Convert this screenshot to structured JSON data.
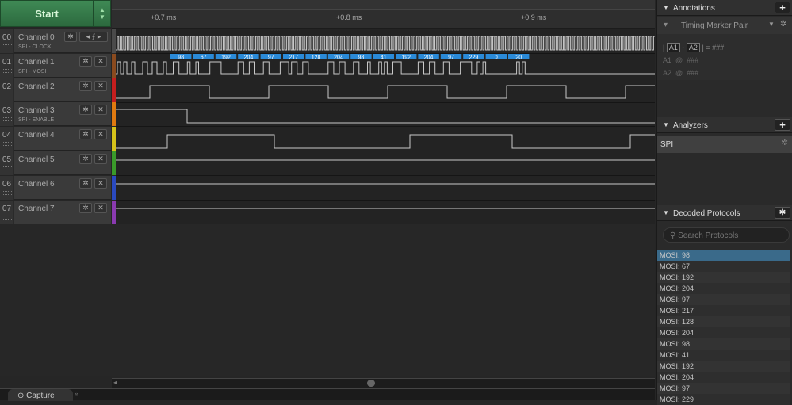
{
  "start_button": "Start",
  "timeline": {
    "ticks": [
      "+0.7 ms",
      "+0.8 ms",
      "+0.9 ms"
    ]
  },
  "channels": [
    {
      "num": "00",
      "name": "Channel 0",
      "sub": "SPI - CLOCK",
      "color": "#4a4a4a"
    },
    {
      "num": "01",
      "name": "Channel 1",
      "sub": "SPI - MOSI",
      "color": "#8a4a1e"
    },
    {
      "num": "02",
      "name": "Channel 2",
      "sub": "",
      "color": "#c41e1e"
    },
    {
      "num": "03",
      "name": "Channel 3",
      "sub": "SPI - ENABLE",
      "color": "#e07a10"
    },
    {
      "num": "04",
      "name": "Channel 4",
      "sub": "",
      "color": "#d6c21a"
    },
    {
      "num": "05",
      "name": "Channel 5",
      "sub": "",
      "color": "#3a9a2a"
    },
    {
      "num": "06",
      "name": "Channel 6",
      "sub": "",
      "color": "#2a4ac0"
    },
    {
      "num": "07",
      "name": "Channel 7",
      "sub": "",
      "color": "#8a3ab0"
    }
  ],
  "decoded_bytes": [
    "98",
    "67",
    "192",
    "204",
    "97",
    "217",
    "128",
    "204",
    "98",
    "41",
    "192",
    "204",
    "97",
    "229",
    "0",
    "20"
  ],
  "bottom_tab": "Capture",
  "annotations": {
    "title": "Annotations",
    "marker": "Timing Marker Pair",
    "formula": [
      "|",
      "A1",
      "-",
      "A2",
      "|",
      "=",
      "###"
    ],
    "a1": [
      "A1",
      "@",
      "###"
    ],
    "a2": [
      "A2",
      "@",
      "###"
    ]
  },
  "analyzers": {
    "title": "Analyzers",
    "items": [
      "SPI"
    ]
  },
  "decoded": {
    "title": "Decoded Protocols",
    "search_placeholder": "Search Protocols",
    "items": [
      "MOSI: 98",
      "MOSI: 67",
      "MOSI: 192",
      "MOSI: 204",
      "MOSI: 97",
      "MOSI: 217",
      "MOSI: 128",
      "MOSI: 204",
      "MOSI: 98",
      "MOSI: 41",
      "MOSI: 192",
      "MOSI: 204",
      "MOSI: 97",
      "MOSI: 229"
    ]
  },
  "colors": {
    "accent": "#2a8ad8",
    "selected": "#3a6a8a"
  }
}
